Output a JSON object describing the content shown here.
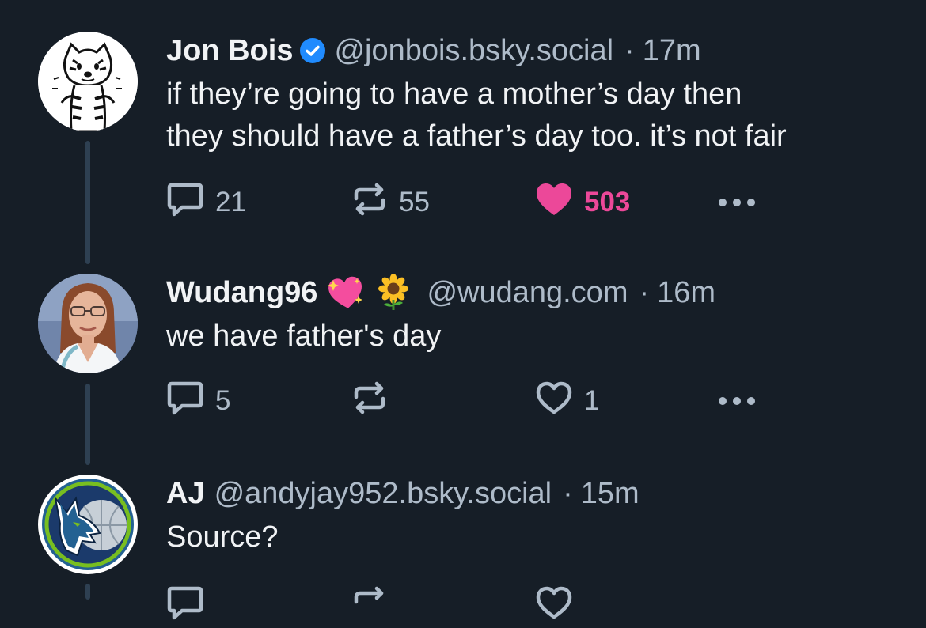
{
  "posts": [
    {
      "author": {
        "name": "Jon Bois",
        "handle": "@jonbois.bsky.social",
        "verified": true,
        "avatar": "calvin-and-hobbes-tiger-drawing"
      },
      "time": "17m",
      "text_lines": [
        "if they’re going to have a mother’s day then",
        "they should have a father’s day too. it’s not fair"
      ],
      "actions": {
        "reply_count": "21",
        "repost_count": "55",
        "like_count": "503",
        "liked": true
      }
    },
    {
      "author": {
        "name": "Wudang96",
        "handle": "@wudang.com",
        "emojis": [
          "sparkling-heart-icon",
          "sunflower-icon"
        ],
        "avatar": "woman-portrait-photo"
      },
      "time": "16m",
      "text_lines": [
        "we have father's day"
      ],
      "actions": {
        "reply_count": "5",
        "repost_count": "",
        "like_count": "1",
        "liked": false
      }
    },
    {
      "author": {
        "name": "AJ",
        "handle": "@andyjay952.bsky.social",
        "avatar": "timberwolves-logo"
      },
      "time": "15m",
      "text_lines": [
        "Source?"
      ]
    }
  ],
  "separator": "·",
  "colors": {
    "background": "#161e27",
    "text": "#f1f3f5",
    "muted": "#aebbc9",
    "like_pink": "#ec4899",
    "verified_blue": "#208bfe",
    "thread_line": "#2e4052"
  }
}
